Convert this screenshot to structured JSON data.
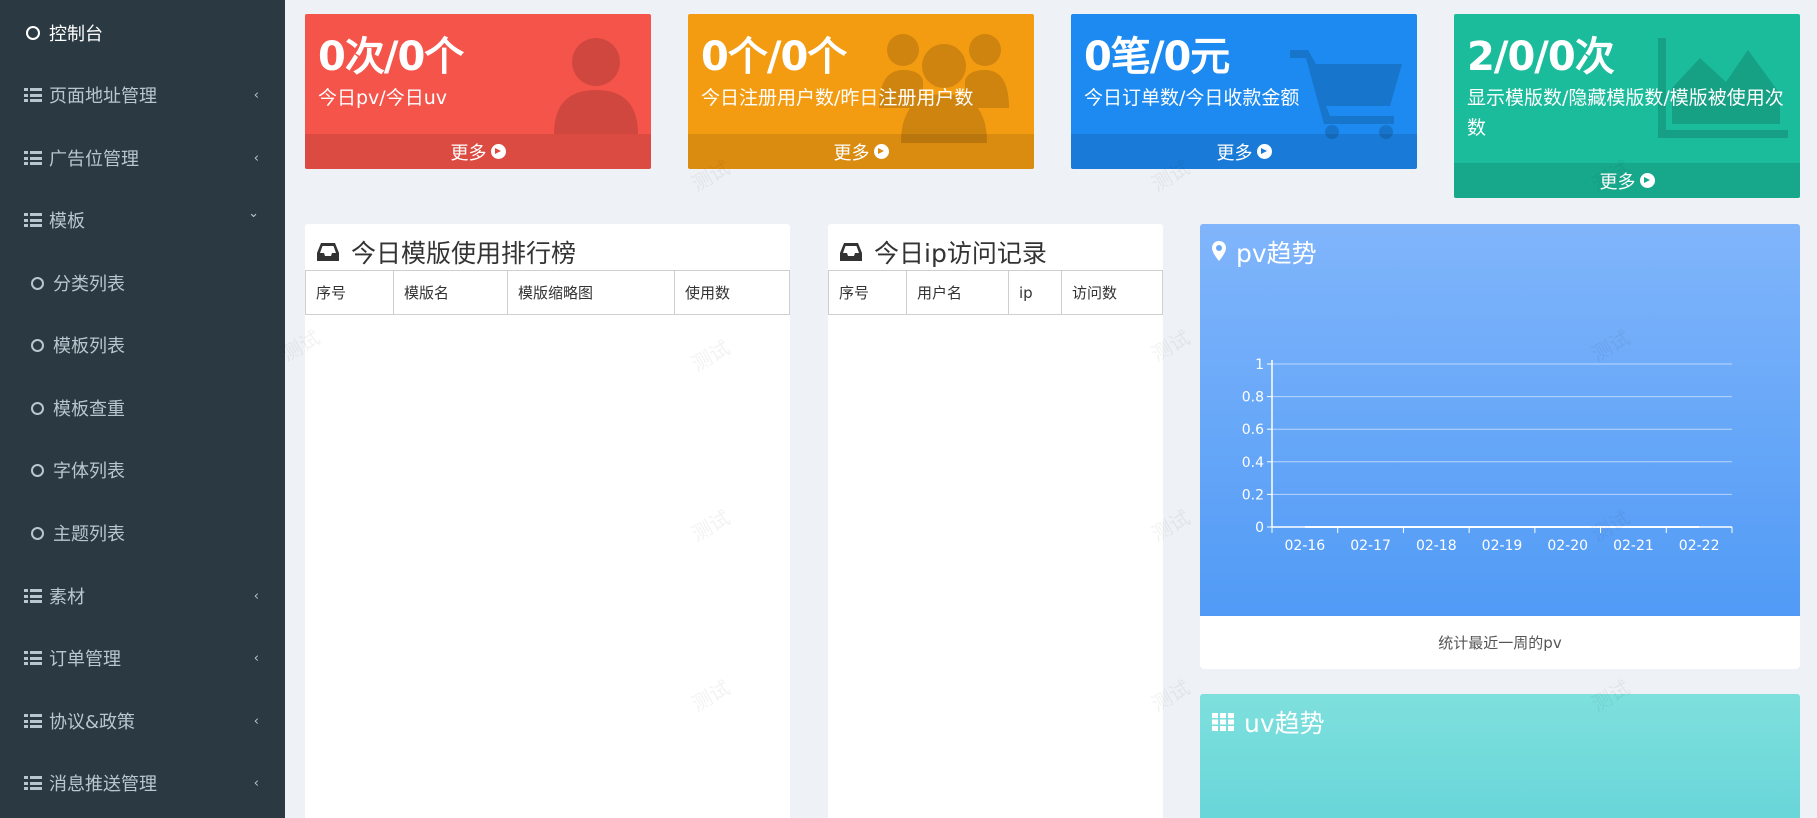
{
  "sidebar": {
    "items": [
      {
        "label": "控制台",
        "icon": "circle-icon",
        "active": true
      },
      {
        "label": "页面地址管理",
        "icon": "list-icon",
        "chevron": "‹"
      },
      {
        "label": "广告位管理",
        "icon": "list-icon",
        "chevron": "‹"
      },
      {
        "label": "模板",
        "icon": "list-icon",
        "chevron": "⌄"
      },
      {
        "label": "分类列表",
        "icon": "circle-icon",
        "sub": true
      },
      {
        "label": "模板列表",
        "icon": "circle-icon",
        "sub": true
      },
      {
        "label": "模板查重",
        "icon": "circle-icon",
        "sub": true
      },
      {
        "label": "字体列表",
        "icon": "circle-icon",
        "sub": true
      },
      {
        "label": "主题列表",
        "icon": "circle-icon",
        "sub": true
      },
      {
        "label": "素材",
        "icon": "list-icon",
        "chevron": "‹"
      },
      {
        "label": "订单管理",
        "icon": "list-icon",
        "chevron": "‹"
      },
      {
        "label": "协议&政策",
        "icon": "list-icon",
        "chevron": "‹"
      },
      {
        "label": "消息推送管理",
        "icon": "list-icon",
        "chevron": "‹"
      }
    ]
  },
  "cards": [
    {
      "value": "0次/0个",
      "desc": "今日pv/今日uv",
      "more": "更多",
      "color": "#f5544a",
      "icon": "user-icon"
    },
    {
      "value": "0个/0个",
      "desc": "今日注册用户数/昨日注册用户数",
      "more": "更多",
      "color": "#f39c12",
      "icon": "users-icon"
    },
    {
      "value": "0笔/0元",
      "desc": "今日订单数/今日收款金额",
      "more": "更多",
      "color": "#1c8af0",
      "icon": "cart-icon"
    },
    {
      "value": "2/0/0次",
      "desc": "显示模版数/隐藏模版数/模版被使用次数",
      "more": "更多",
      "color": "#1abc9c",
      "icon": "area-chart-icon"
    }
  ],
  "ranking": {
    "title": "今日模版使用排行榜",
    "columns": [
      "序号",
      "模版名",
      "模版缩略图",
      "使用数"
    ]
  },
  "ip_log": {
    "title": "今日ip访问记录",
    "columns": [
      "序号",
      "用户名",
      "ip",
      "访问数"
    ]
  },
  "pv": {
    "title": "pv趋势",
    "footer": "统计最近一周的pv"
  },
  "uv": {
    "title": "uv趋势"
  },
  "watermark_text": "测试",
  "chart_data": {
    "type": "line",
    "categories": [
      "02-16",
      "02-17",
      "02-18",
      "02-19",
      "02-20",
      "02-21",
      "02-22"
    ],
    "series": [
      {
        "values": [
          0,
          0,
          0,
          0,
          0,
          0,
          0
        ]
      }
    ],
    "ylim": [
      0,
      1
    ],
    "yticks": [
      "0",
      "0.2",
      "0.4",
      "0.6",
      "0.8",
      "1"
    ],
    "grid": true
  }
}
